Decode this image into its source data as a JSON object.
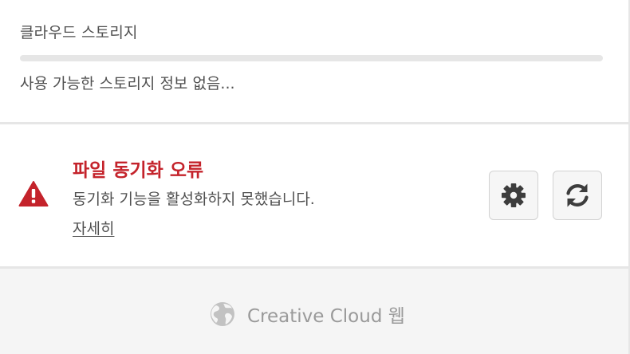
{
  "storage": {
    "title": "클라우드 스토리지",
    "usage_fraction": 0,
    "status": "사용 가능한 스토리지 정보 없음..."
  },
  "sync": {
    "title": "파일 동기화 오류",
    "message": "동기화 기능을 활성화하지 못했습니다.",
    "link_label": "자세히",
    "warning_icon": "warning-triangle-icon",
    "settings_icon": "gear-icon",
    "refresh_icon": "refresh-icon",
    "error_color": "#c4232b"
  },
  "footer": {
    "link_label": "Creative Cloud 웹",
    "icon": "globe-icon"
  }
}
